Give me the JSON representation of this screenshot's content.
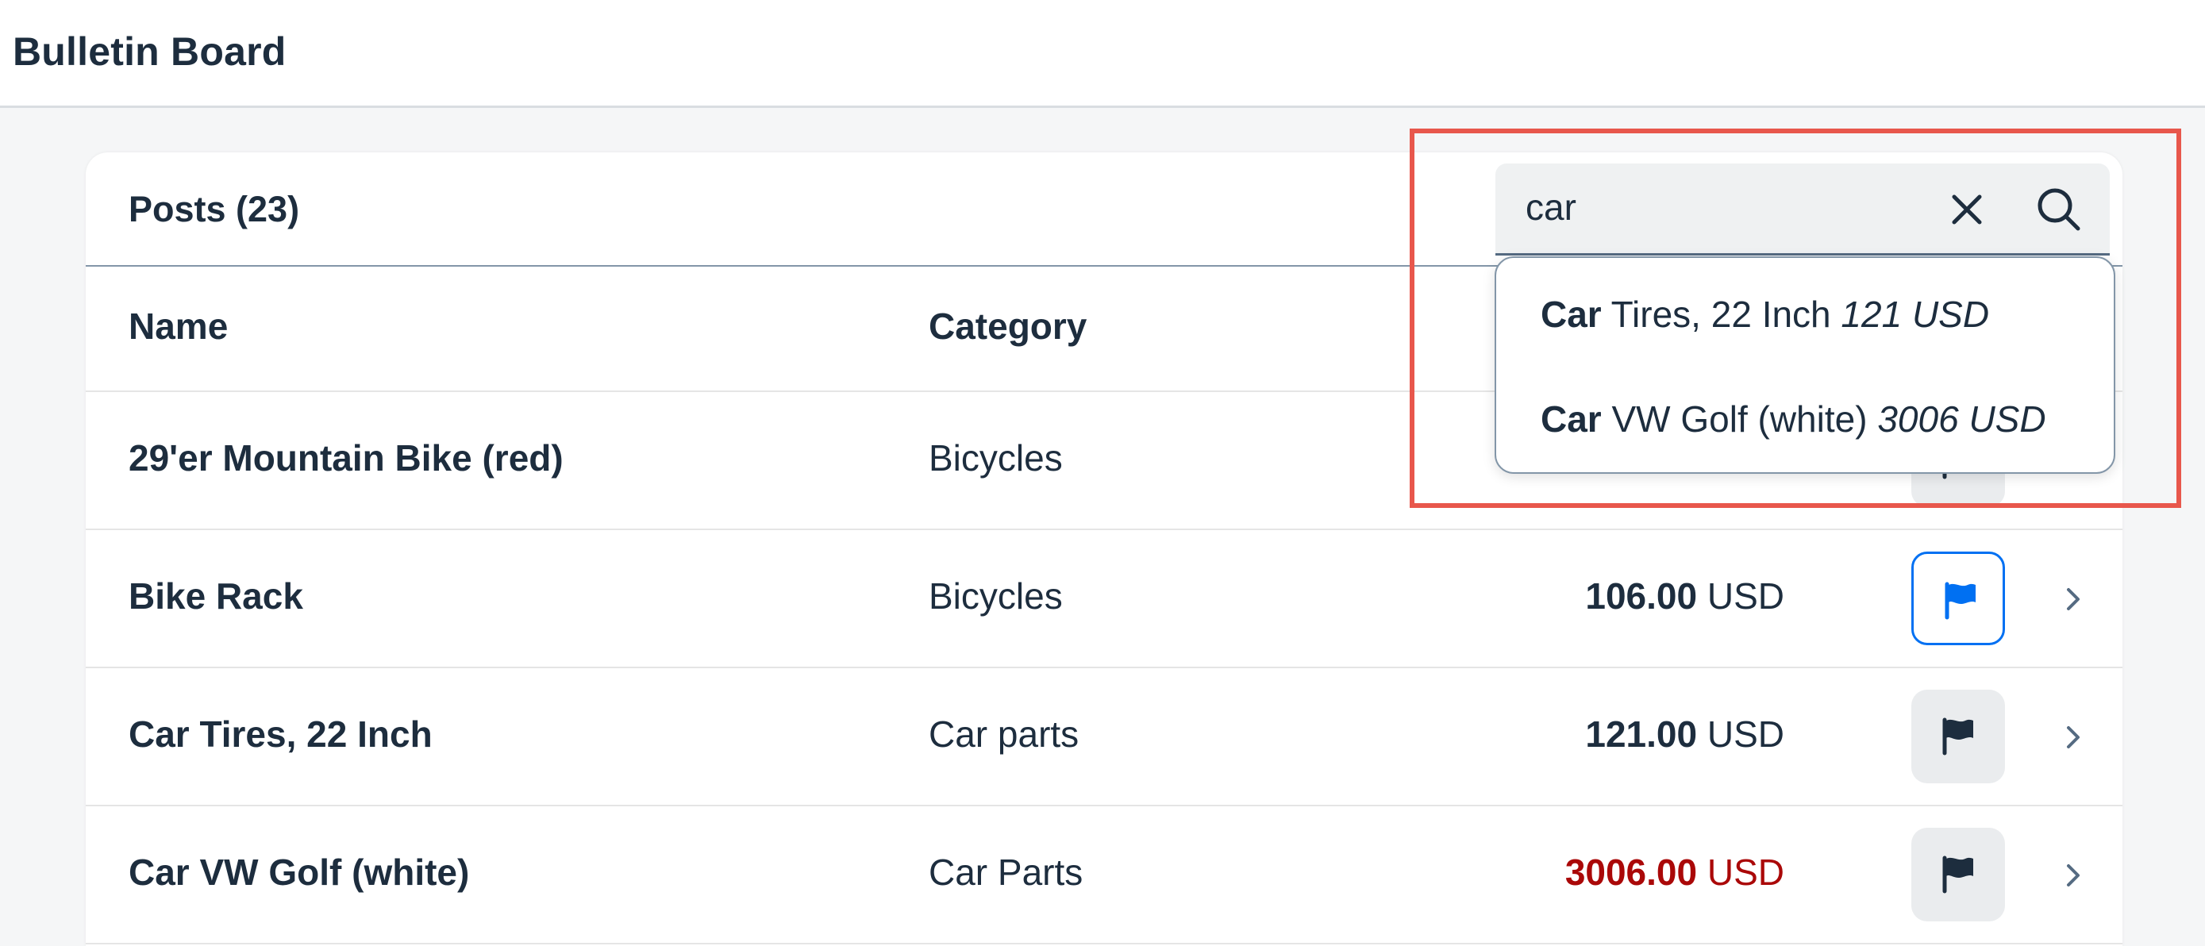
{
  "app": {
    "title": "Bulletin Board"
  },
  "table": {
    "title": "Posts (23)",
    "columns": {
      "name": "Name",
      "category": "Category"
    },
    "rows": [
      {
        "name": "29'er Mountain Bike (red)",
        "category": "Bicycles",
        "price_amount": "",
        "currency": "",
        "flag_state": "default",
        "obscured": true
      },
      {
        "name": "Bike Rack",
        "category": "Bicycles",
        "price_amount": "106.00",
        "currency": "USD",
        "flag_state": "active"
      },
      {
        "name": "Car Tires, 22 Inch",
        "category": "Car parts",
        "price_amount": "121.00",
        "currency": "USD",
        "flag_state": "default"
      },
      {
        "name": "Car VW Golf (white)",
        "category": "Car Parts",
        "price_amount": "3006.00",
        "currency": "USD",
        "flag_state": "default",
        "price_status": "high"
      }
    ]
  },
  "search": {
    "value": "car",
    "clear_icon": "close-icon",
    "search_icon": "search-icon"
  },
  "suggestions": [
    {
      "match": "Car",
      "rest": " Tires, 22 Inch ",
      "price": "121 USD"
    },
    {
      "match": "Car",
      "rest": " VW Golf (white) ",
      "price": "3006 USD"
    }
  ],
  "colors": {
    "accent": "#0070f2",
    "text": "#1d2d3e",
    "negative": "#aa0808",
    "highlight_box": "#e8574c",
    "background": "#f5f6f7"
  }
}
